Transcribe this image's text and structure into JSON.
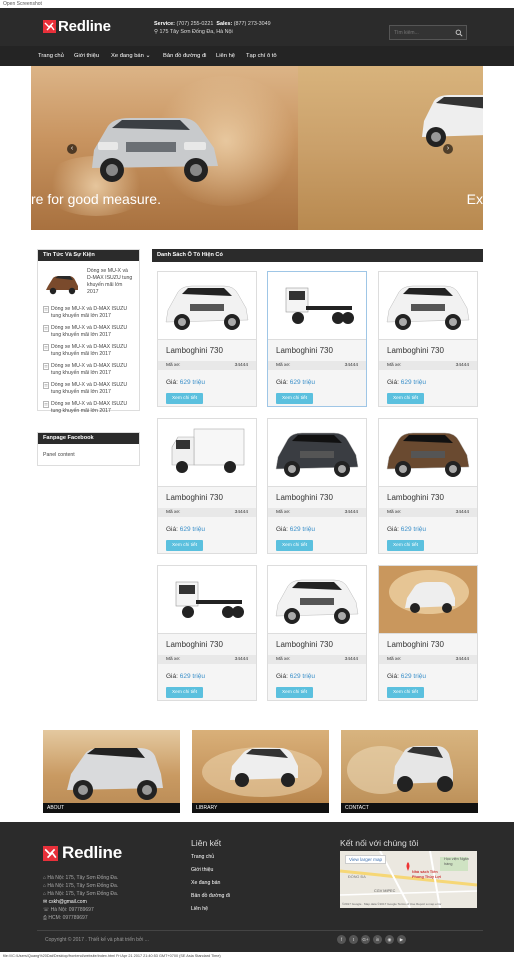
{
  "window_title": "Open Screenshot",
  "header": {
    "brand": "Redline",
    "service_label": "Service:",
    "service_phone": "(707) 255-0221",
    "sales_label": "Sales:",
    "sales_phone": "(877) 273-3049",
    "address": "175 Tây Sơn Đống Đa, Hà Nội",
    "search_placeholder": "Tìm kiếm..."
  },
  "nav": {
    "items": [
      "Trang chủ",
      "Giới thiệu",
      "Xe đang bán",
      "Bản đồ đường đi",
      "Liên hệ",
      "Tạp chí ô tô"
    ]
  },
  "slider": {
    "caption_left": "re for good measure.",
    "caption_right": "Ex",
    "active_slide": 1,
    "slide_count": 3
  },
  "sidebar": {
    "news_title": "Tin Tức Và Sự Kiện",
    "featured_text": "Dòng xe MU-X và D-MAX ISUZU tung khuyến mãi lớn 2017",
    "news_items": [
      "Dòng xe MU-X và D-MAX ISUZU tung khuyến mãi lớn 2017",
      "Dòng xe MU-X và D-MAX ISUZU tung khuyến mãi lớn 2017",
      "Dòng xe MU-X và D-MAX ISUZU tung khuyến mãi lớn 2017",
      "Dòng xe MU-X và D-MAX ISUZU tung khuyến mãi lớn 2017",
      "Dòng xe MU-X và D-MAX ISUZU tung khuyến mãi lớn 2017",
      "Dòng xe MU-X và D-MAX ISUZU tung khuyến mãi lớn 2017"
    ],
    "fanpage_title": "Fanpage Facebook",
    "fanpage_content": "Panel content"
  },
  "products": {
    "heading": "Danh Sách Ô Tô Hiện Có",
    "code_label": "Mã xe:",
    "price_label": "Giá:",
    "button_label": "Xem chi tiết",
    "items": [
      {
        "name": "Lamboghini 730",
        "code": "34444",
        "price": "629 triệu",
        "image": "white-suv"
      },
      {
        "name": "Lamboghini 730",
        "code": "34444",
        "price": "629 triệu",
        "image": "truck-chassis"
      },
      {
        "name": "Lamboghini 730",
        "code": "34444",
        "price": "629 triệu",
        "image": "white-suv"
      },
      {
        "name": "Lamboghini 730",
        "code": "34444",
        "price": "629 triệu",
        "image": "box-truck"
      },
      {
        "name": "Lamboghini 730",
        "code": "34444",
        "price": "629 triệu",
        "image": "dark-suv"
      },
      {
        "name": "Lamboghini 730",
        "code": "34444",
        "price": "629 triệu",
        "image": "brown-suv"
      },
      {
        "name": "Lamboghini 730",
        "code": "34444",
        "price": "629 triệu",
        "image": "truck-chassis"
      },
      {
        "name": "Lamboghini 730",
        "code": "34444",
        "price": "629 triệu",
        "image": "white-suv"
      },
      {
        "name": "Lamboghini 730",
        "code": "34444",
        "price": "629 triệu",
        "image": "desert-car"
      }
    ]
  },
  "tiles": [
    "ABOUT",
    "LIBRARY",
    "CONTACT"
  ],
  "footer": {
    "brand": "Redline",
    "addresses": [
      "Hà Nội: 175, Tây Sơn Đống Đa.",
      "Hà Nội: 175, Tây Sơn Đống Đa.",
      "Hà Nội: 175, Tây Sơn Đống Đa."
    ],
    "email": "cskh@gmail.com",
    "phone_hn": "Hà Nội: 097789697",
    "phone_hcm": "HCM: 097789697",
    "links_title": "Liên kết",
    "links": [
      "Trang chủ",
      "Giới thiệu",
      "Xe đang bán",
      "Bản đồ đường đi",
      "Liên hệ"
    ],
    "connect_title": "Kết nối với chúng tôi",
    "map_button": "View larger map",
    "map_labels": {
      "place": "Nhà sách Tiên Phong Thủy Lợi",
      "area1": "Học viện Ngân hàng",
      "area2": "ĐỐNG ĐA",
      "area3": "CGV MIPEC",
      "credit": "©2017 Google · Map data ©2017 Google  Terms of Use  Report a map error"
    },
    "copyright": "Copyright © 2017 . Thiết kế và phát triển bởi ...",
    "socials": [
      "f",
      "t",
      "G+",
      "in",
      "◉",
      "▶"
    ]
  },
  "status_bar": "file:///C:/Users/Quang%20Dat/Desktop/frontend/website/index.html  Fri Apr 21 2017 21:40:53 GMT+0700 (SE Asia Standard Time)"
}
